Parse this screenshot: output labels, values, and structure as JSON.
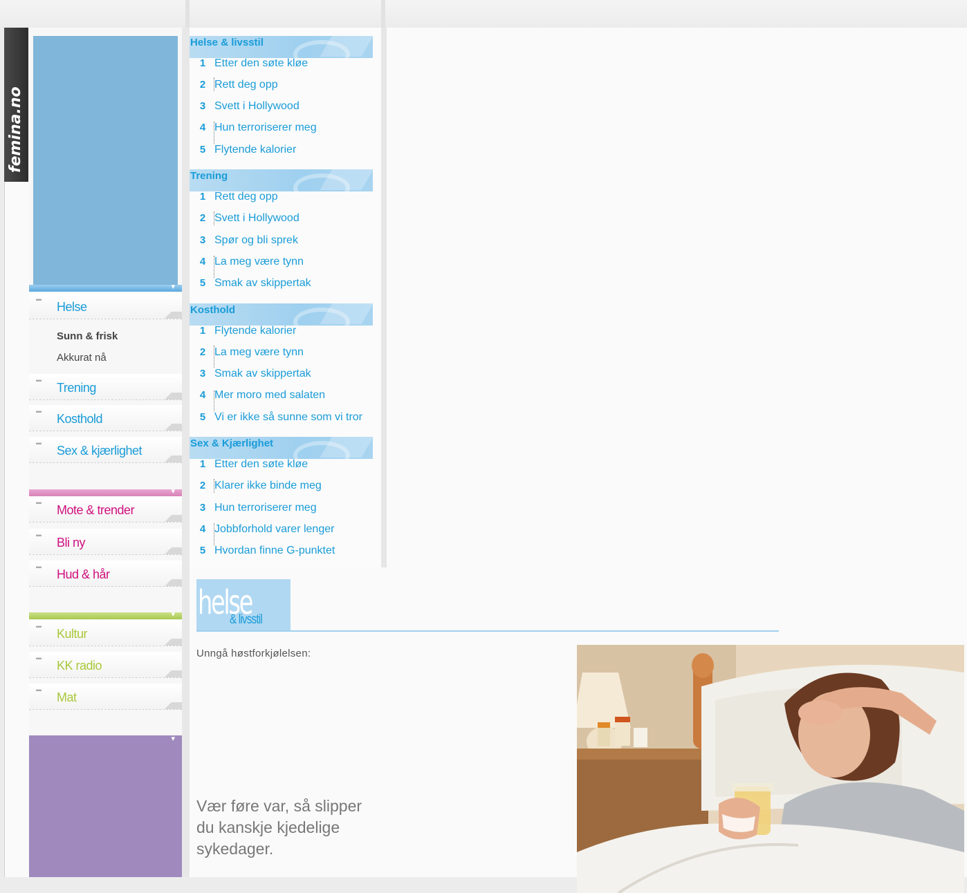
{
  "brand": {
    "tab_label": "femina.no"
  },
  "sidebar": {
    "blue_items": [
      {
        "label": "Helse"
      },
      {
        "label": "Trening"
      },
      {
        "label": "Kosthold"
      },
      {
        "label": "Sex & kjærlighet"
      }
    ],
    "sub_items": [
      {
        "label": "Sunn & frisk"
      },
      {
        "label": "Akkurat nå"
      }
    ],
    "pink_items": [
      {
        "label": "Mote & trender"
      },
      {
        "label": "Bli ny"
      },
      {
        "label": "Hud & hår"
      }
    ],
    "green_items": [
      {
        "label": "Kultur"
      },
      {
        "label": "KK radio"
      },
      {
        "label": "Mat"
      }
    ]
  },
  "sections": [
    {
      "title": "Helse & livsstil",
      "items": [
        {
          "num": "1",
          "label": "Etter den søte kløe"
        },
        {
          "num": "2",
          "label": "Rett deg opp"
        },
        {
          "num": "3",
          "label": "Svett i Hollywood"
        },
        {
          "num": "4",
          "label": "Hun terroriserer meg"
        },
        {
          "num": "5",
          "label": "Flytende kalorier"
        }
      ]
    },
    {
      "title": "Trening",
      "items": [
        {
          "num": "1",
          "label": "Rett deg opp"
        },
        {
          "num": "2",
          "label": "Svett i Hollywood"
        },
        {
          "num": "3",
          "label": "Spør og bli sprek"
        },
        {
          "num": "4",
          "label": "La meg være tynn"
        },
        {
          "num": "5",
          "label": "Smak av skippertak"
        }
      ]
    },
    {
      "title": "Kosthold",
      "items": [
        {
          "num": "1",
          "label": "Flytende kalorier"
        },
        {
          "num": "2",
          "label": "La meg være tynn"
        },
        {
          "num": "3",
          "label": "Smak av skippertak"
        },
        {
          "num": "4",
          "label": "Mer moro med salaten"
        },
        {
          "num": "5",
          "label": "Vi er ikke så sunne som vi tror"
        }
      ]
    },
    {
      "title": "Sex & Kjærlighet",
      "items": [
        {
          "num": "1",
          "label": "Etter den søte kløe"
        },
        {
          "num": "2",
          "label": "Klarer ikke binde meg"
        },
        {
          "num": "3",
          "label": "Hun terroriserer meg"
        },
        {
          "num": "4",
          "label": "Jobbforhold varer lenger"
        },
        {
          "num": "5",
          "label": "Hvordan finne G-punktet"
        }
      ]
    }
  ],
  "article": {
    "logo_big": "helse",
    "logo_small": "& livsstil",
    "intro": "Unngå høstforkjølelsen:",
    "lead": "Vær føre var, så slipper du kanskje kjedelige sykedager."
  },
  "colors": {
    "accent_blue": "#1a9cd8",
    "accent_pink": "#d0117f",
    "accent_green": "#a9c83a",
    "ad_purple": "#9f89bd",
    "ad_blue": "#7fb6d9"
  }
}
